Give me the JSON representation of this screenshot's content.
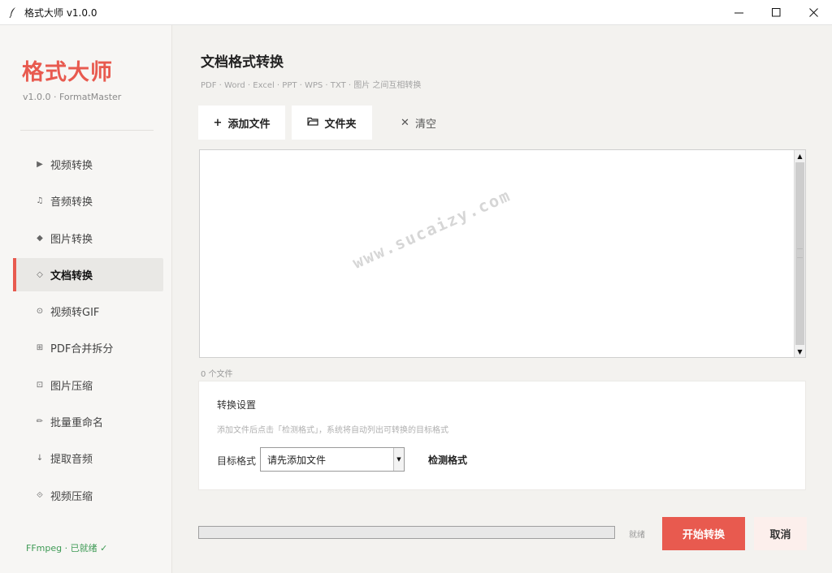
{
  "window": {
    "title": "格式大师 v1.0.0",
    "icon": "feather-icon",
    "controls": [
      "minimize-icon",
      "maximize-icon",
      "close-icon"
    ]
  },
  "sidebar": {
    "brand": "格式大师",
    "version": "v1.0.0 · FormatMaster",
    "items": [
      {
        "icon": "▶",
        "label": "视频转换"
      },
      {
        "icon": "♫",
        "label": "音频转换"
      },
      {
        "icon": "◆",
        "label": "图片转换"
      },
      {
        "icon": "◇",
        "label": "文档转换"
      },
      {
        "icon": "⊙",
        "label": "视频转GIF"
      },
      {
        "icon": "⊞",
        "label": "PDF合并拆分"
      },
      {
        "icon": "⊡",
        "label": "图片压缩"
      },
      {
        "icon": "✏",
        "label": "批量重命名"
      },
      {
        "icon": "↓",
        "label": "提取音频"
      },
      {
        "icon": "⟐",
        "label": "视频压缩"
      }
    ],
    "active_index": 3,
    "ffmpeg_status": "FFmpeg · 已就绪 ✓"
  },
  "main": {
    "title": "文档格式转换",
    "subtitle": "PDF · Word · Excel · PPT · WPS · TXT · 图片 之间互相转换",
    "toolbar": {
      "add_glyph": "+",
      "add_label": "添加文件",
      "folder_glyph": "🗀",
      "folder_label": "文件夹",
      "clear_glyph": "✕",
      "clear_label": "清空"
    },
    "watermark": "www.sucaizy.com",
    "file_count": "0 个文件",
    "settings": {
      "title": "转换设置",
      "hint": "添加文件后点击「检测格式」，系统将自动列出可转换的目标格式",
      "target_label": "目标格式",
      "select_value": "请先添加文件",
      "detect_label": "检测格式"
    },
    "progress": 0,
    "status": "就绪",
    "start_label": "开始转换",
    "cancel_label": "取消"
  },
  "colors": {
    "accent": "#e85a4f",
    "ok": "#3e9a55"
  }
}
